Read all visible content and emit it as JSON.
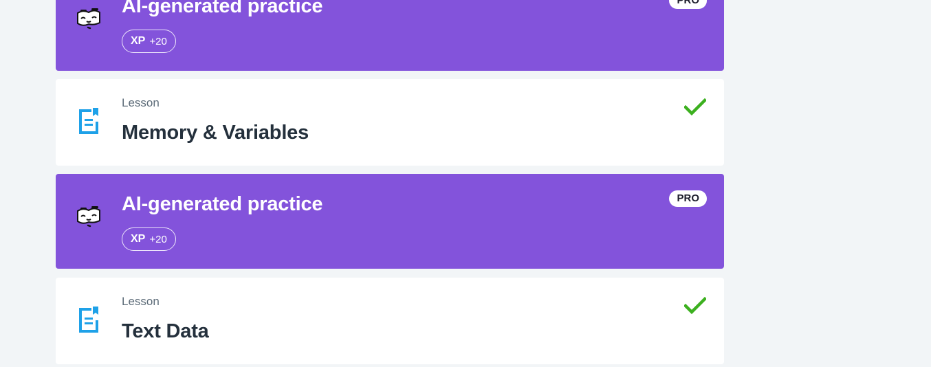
{
  "items": [
    {
      "kind": "practice",
      "title": "AI-generated practice",
      "xp_label": "XP",
      "xp_value": "+20",
      "badge": "PRO",
      "icon": "ai-mascot-icon"
    },
    {
      "kind": "lesson",
      "kind_label": "Lesson",
      "title": "Memory & Variables",
      "completed": true,
      "icon": "lesson-document-icon"
    },
    {
      "kind": "practice",
      "title": "AI-generated practice",
      "xp_label": "XP",
      "xp_value": "+20",
      "badge": "PRO",
      "icon": "ai-mascot-icon"
    },
    {
      "kind": "lesson",
      "kind_label": "Lesson",
      "title": "Text Data",
      "completed": true,
      "icon": "lesson-document-icon"
    }
  ],
  "colors": {
    "practice_bg": "#8353db",
    "lesson_bg": "#ffffff",
    "page_bg": "#f2f5f7",
    "lesson_icon": "#1ea1e8",
    "check": "#3cb01f"
  }
}
